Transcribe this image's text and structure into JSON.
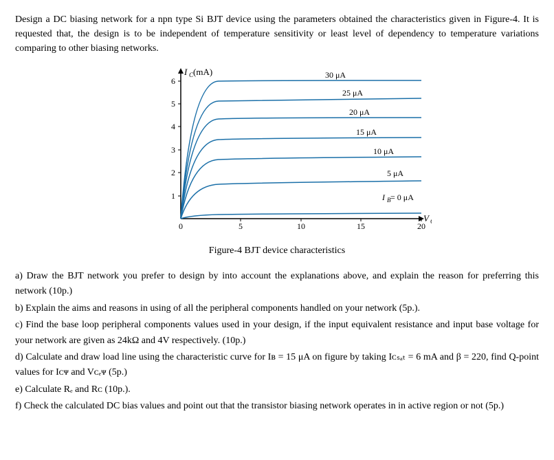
{
  "intro": {
    "text": "Design a DC biasing network for a npn type Si BJT device using the parameters obtained the characteristics given in Figure-4. It is requested that, the design is to be independent of temperature sensitivity or least level of dependency to temperature variations comparing to other biasing networks."
  },
  "figure": {
    "caption": "Figure-4 BJT device characteristics",
    "yaxis_label": "I₁ (mA)",
    "xaxis_label": "Vₜₑ",
    "curves": [
      {
        "label": "30 μA",
        "ib": 30
      },
      {
        "label": "25 μA",
        "ib": 25
      },
      {
        "label": "20 μA",
        "ib": 20
      },
      {
        "label": "15 μA",
        "ib": 15
      },
      {
        "label": "10 μA",
        "ib": 10
      },
      {
        "label": "5 μA",
        "ib": 5
      },
      {
        "label": "Iʙ = 0 μA",
        "ib": 0
      }
    ],
    "x_ticks": [
      0,
      5,
      10,
      15,
      20
    ],
    "y_ticks": [
      0,
      1,
      2,
      3,
      4,
      5,
      6
    ]
  },
  "questions": {
    "a": "a) Draw the BJT network you prefer to design by into account the explanations above, and explain the reason for preferring this network (10p.)",
    "b": "b) Explain the aims and reasons in using of all the peripheral components handled on your network (5p.).",
    "c": "c) Find the base loop peripheral components values used in your design, if the input equivalent resistance and input base voltage for your network are given as 24kΩ and 4V respectively. (10p.)",
    "d": "d) Calculate and draw load line using the characteristic curve for Iʙ = 15 μA on figure by taking Iᴄₛₐₜ = 6 mA and β = 220, find Q-point values for Iᴄᴪ and Vᴄₑᴪ (5p.)",
    "e": "e) Calculate Rₑ and Rᴄ (10p.).",
    "f": "f) Check the calculated DC bias values and point out that the transistor biasing network operates in in active region or not (5p.)"
  }
}
